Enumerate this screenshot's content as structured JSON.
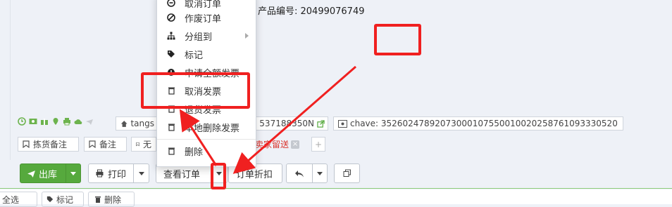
{
  "product": {
    "code_text": "产品编号: 20499076749"
  },
  "tags": {
    "store_partial": "tangs",
    "tracking_partial": "537188350N",
    "chave_text": "chave: 35260247892073000107550010020258761093330520"
  },
  "notes": {
    "picking_note": "拣货备注",
    "note": "备注",
    "none_partial": "无",
    "seller_partial": "卖家留送",
    "add": "+"
  },
  "toolbar": {
    "ship_label": "出库",
    "print_label": "打印",
    "view_order_label": "查看订单",
    "order_discount_label": "订单折扣"
  },
  "context_menu": {
    "items": [
      {
        "label": "取消订单",
        "icon": "cancel-icon"
      },
      {
        "label": "作废订单",
        "icon": "ban-icon"
      },
      {
        "label": "分组到",
        "icon": "sitemap-icon",
        "submenu": true
      },
      {
        "label": "标记",
        "icon": "tag-icon"
      },
      {
        "label": "申请全额发票",
        "icon": "invoice-icon"
      },
      {
        "label": "取消发票",
        "icon": "trash-icon"
      },
      {
        "label": "退货发票",
        "icon": "trash-icon"
      },
      {
        "label": "本地删除发票",
        "icon": "trash-icon"
      },
      {
        "label": "删除",
        "icon": "trash-icon"
      }
    ]
  },
  "bottom_bar": {
    "item_partial": "全选",
    "mark_label": "标记",
    "delete_label": "删除"
  },
  "colors": {
    "accent_green": "#56a93d",
    "annotation_red": "#f02020",
    "link_red": "#d9322b"
  }
}
